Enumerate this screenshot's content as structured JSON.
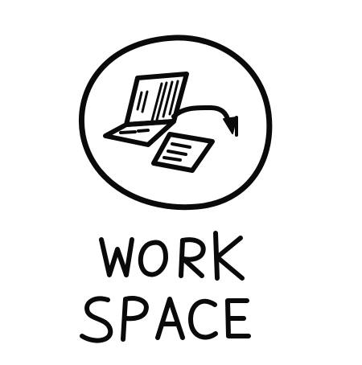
{
  "logo": {
    "line1": "WORK",
    "line2": "SPACE"
  },
  "icons": {
    "emblem": "workspace-emblem-icon",
    "laptop": "laptop-icon",
    "paper": "document-icon"
  },
  "colors": {
    "ink": "#0a0a0a",
    "background": "#ffffff"
  }
}
